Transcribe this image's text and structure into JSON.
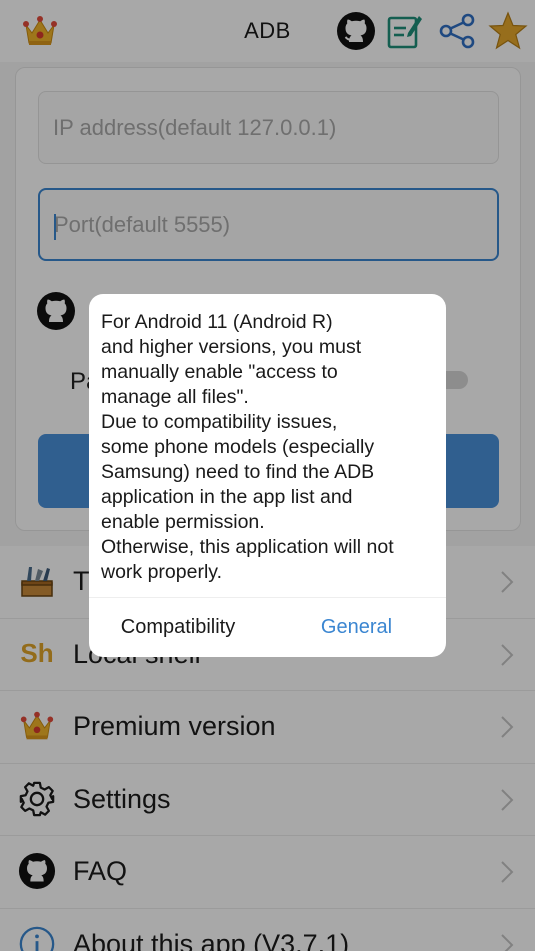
{
  "header": {
    "title": "ADB",
    "icons": [
      "crown-icon",
      "github-icon",
      "edit-note-icon",
      "share-icon",
      "star-icon"
    ]
  },
  "connect_form": {
    "ip_placeholder": "IP address(default 127.0.0.1)",
    "port_placeholder": "Port(default 5555)",
    "partial_label": "Pa",
    "toggle_on": false,
    "button_color": "#4a90d9"
  },
  "menu": {
    "items": [
      {
        "label": "T",
        "icon": "toolbox-icon"
      },
      {
        "label": "Local shell",
        "icon": "sh-icon",
        "icon_text": "Sh"
      },
      {
        "label": "Premium version",
        "icon": "crown-icon"
      },
      {
        "label": "Settings",
        "icon": "gear-icon"
      },
      {
        "label": "FAQ",
        "icon": "github-icon"
      },
      {
        "label": "About this app (V3.7.1)",
        "icon": "info-icon"
      }
    ]
  },
  "dialog": {
    "message": "For Android 11 (Android R)\nand higher versions, you must\nmanually enable \"access to\nmanage all files\".\nDue to compatibility issues,\nsome phone models (especially\nSamsung) need to find the ADB\napplication in the app list and\nenable permission.\nOtherwise, this application will not\nwork properly.",
    "buttons": {
      "compatibility": "Compatibility",
      "general": "General"
    }
  },
  "colors": {
    "accent": "#3b86d1",
    "gold": "#e0a52a",
    "overlay": "rgba(0,0,0,0.34)"
  }
}
